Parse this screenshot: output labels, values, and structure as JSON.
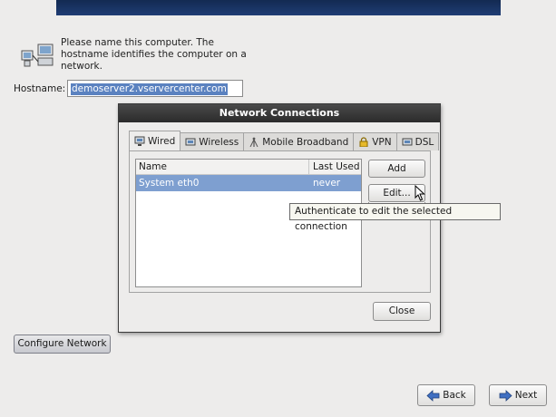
{
  "installer": {
    "intro_text": "Please name this computer.  The hostname identifies the computer on a network.",
    "hostname_label": "Hostname:",
    "hostname_value": "demoserver2.vservercenter.com",
    "configure_network_label": "Configure Network",
    "back_label": "Back",
    "next_label": "Next"
  },
  "dialog": {
    "title": "Network Connections",
    "tabs": [
      {
        "label": "Wired",
        "icon": "wired-icon",
        "active": true
      },
      {
        "label": "Wireless",
        "icon": "wireless-icon",
        "active": false
      },
      {
        "label": "Mobile Broadband",
        "icon": "mobile-broadband-icon",
        "active": false
      },
      {
        "label": "VPN",
        "icon": "vpn-lock-icon",
        "active": false
      },
      {
        "label": "DSL",
        "icon": "dsl-icon",
        "active": false
      }
    ],
    "columns": [
      "Name",
      "Last Used"
    ],
    "rows": [
      {
        "name": "System eth0",
        "last_used": "never",
        "selected": true
      }
    ],
    "add_label": "Add",
    "edit_label": "Edit...",
    "close_label": "Close",
    "tooltip": "Authenticate to edit the selected connection"
  },
  "colors": {
    "selection": "#7e9fd0",
    "titlebar": "#2b2b2b",
    "banner": "#1f3d74"
  }
}
